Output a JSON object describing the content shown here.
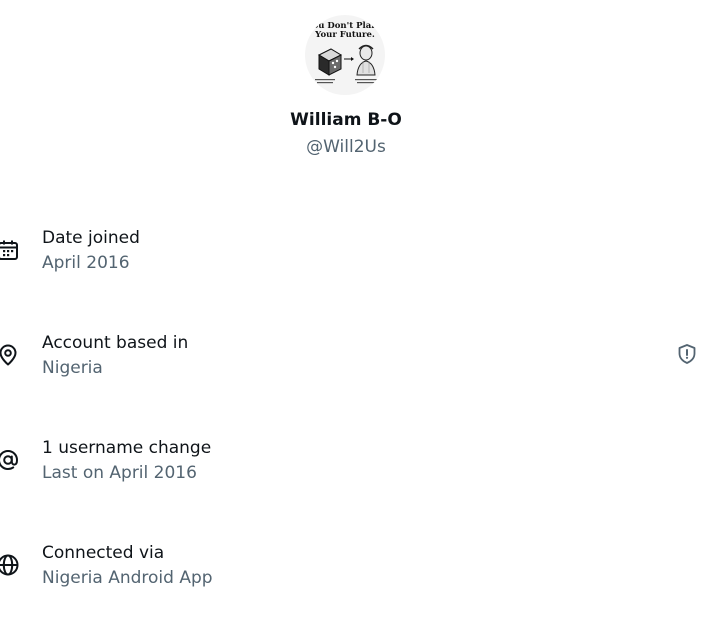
{
  "profile": {
    "avatar_caption_line1": "ou Don't Plan",
    "avatar_caption_line2": "Your Future.",
    "display_name": "William B-O",
    "handle": "@Will2Us"
  },
  "about": {
    "items": [
      {
        "icon": "calendar-icon",
        "label": "Date joined",
        "value": "April 2016"
      },
      {
        "icon": "location-pin-icon",
        "label": "Account based in",
        "value": "Nigeria",
        "trailing_icon": "shield-alert-icon"
      },
      {
        "icon": "at-sign-icon",
        "label": "1 username change",
        "value": "Last on April 2016"
      },
      {
        "icon": "globe-icon",
        "label": "Connected via",
        "value": "Nigeria Android App"
      }
    ]
  },
  "colors": {
    "primary_text": "#0f1419",
    "secondary_text": "#536471",
    "background": "#ffffff"
  }
}
